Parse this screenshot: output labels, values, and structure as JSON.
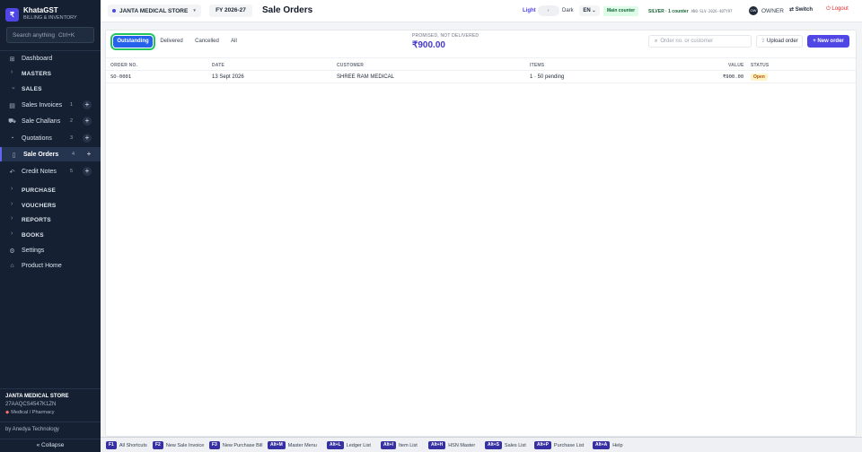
{
  "app": {
    "name": "KhataGST",
    "subtitle": "BILLING & INVENTORY",
    "logo_glyph": "₹"
  },
  "sidebar": {
    "search_placeholder": "Search anything",
    "search_shortcut": "Ctrl+K",
    "items": [
      {
        "label": "Dashboard",
        "icon": "dashboard-icon",
        "glyph": "⊞"
      },
      {
        "label": "MASTERS",
        "glyph": "›"
      },
      {
        "label": "SALES",
        "glyph": "⌄"
      },
      {
        "label": "Sales Invoices",
        "count": "1",
        "icon": "invoice-icon",
        "glyph": "▤"
      },
      {
        "label": "Sale Challans",
        "count": "2",
        "icon": "challan-icon",
        "glyph": "⛟"
      },
      {
        "label": "Quotations",
        "count": "3",
        "icon": "quotation-icon",
        "glyph": "◔"
      },
      {
        "label": "Sale Orders",
        "count": "4",
        "icon": "order-icon",
        "glyph": "▯"
      },
      {
        "label": "Credit Notes",
        "count": "5",
        "icon": "credit-note-icon",
        "glyph": "↶"
      },
      {
        "label": "PURCHASE",
        "glyph": "›"
      },
      {
        "label": "VOUCHERS",
        "glyph": "›"
      },
      {
        "label": "REPORTS",
        "glyph": "›"
      },
      {
        "label": "BOOKS",
        "glyph": "›"
      },
      {
        "label": "Settings",
        "icon": "settings-icon",
        "glyph": "⚙"
      },
      {
        "label": "Product Home",
        "icon": "home-icon",
        "glyph": "⌂"
      }
    ],
    "plus": "+",
    "footer": {
      "store": "JANTA MEDICAL STORE",
      "gstin": "27AAQCS4547K1ZN",
      "category": "Medical / Pharmacy",
      "by_line": "by Anedya Technology",
      "collapse": "« Collapse"
    }
  },
  "topbar": {
    "store": "JANTA MEDICAL STORE",
    "fy": "FY 2026-27",
    "page_title": "Sale Orders",
    "theme_light": "Light",
    "theme_dark": "Dark",
    "lang": "EN",
    "counter": "Main counter",
    "license": "SILVER · 1 counter",
    "license_code": "ANO-SLV-2026-40TY97",
    "owner_initials": "OW",
    "owner": "OWNER",
    "switch": "Switch",
    "logout": "Logout"
  },
  "tabs": [
    "Outstanding",
    "Delivered",
    "Cancelled",
    "All"
  ],
  "promised": {
    "label": "PROMISED, NOT DELIVERED",
    "amount": "₹900.00"
  },
  "search": {
    "placeholder": "Order no. or customer"
  },
  "actions": {
    "upload": "Upload order",
    "new_order": "+ New order"
  },
  "table": {
    "columns": [
      "ORDER NO.",
      "DATE",
      "CUSTOMER",
      "ITEMS",
      "VALUE",
      "STATUS"
    ],
    "rows": [
      {
        "order_no": "SO-0001",
        "date": "13 Sept 2026",
        "customer": "SHREE RAM MEDICAL",
        "items": "1 · 50 pending",
        "value": "₹900.00",
        "status": "Open"
      }
    ]
  },
  "shortcuts": [
    {
      "key": "F1",
      "label": "All Shortcuts"
    },
    {
      "key": "F2",
      "label": "New Sale Invoice"
    },
    {
      "key": "F3",
      "label": "New Purchase Bill"
    },
    {
      "key": "Alt+M",
      "label": "Master Menu"
    },
    {
      "key": "Alt+L",
      "label": "Ledger List"
    },
    {
      "key": "Alt+I",
      "label": "Item List"
    },
    {
      "key": "Alt+H",
      "label": "HSN Master"
    },
    {
      "key": "Alt+S",
      "label": "Sales List"
    },
    {
      "key": "Alt+P",
      "label": "Purchase List"
    },
    {
      "key": "Alt+A",
      "label": "Help"
    }
  ],
  "colors": {
    "sidebar_bg": "#152033",
    "accent": "#4f46e5",
    "active_tab": "#2563eb",
    "status_open": "#b45309"
  }
}
